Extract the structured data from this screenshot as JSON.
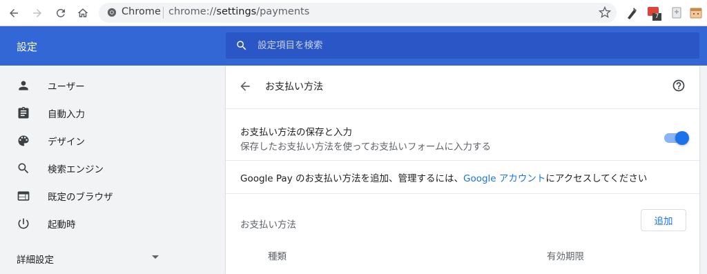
{
  "browser": {
    "omnibox_chrome_label": "Chrome",
    "url_prefix": "chrome://",
    "url_host": "settings",
    "url_path": "/payments",
    "extension_badge": "7"
  },
  "header": {
    "title": "設定",
    "search_placeholder": "設定項目を検索"
  },
  "sidebar": {
    "items": [
      {
        "label": "ユーザー",
        "icon": "person-icon"
      },
      {
        "label": "自動入力",
        "icon": "clipboard-icon"
      },
      {
        "label": "デザイン",
        "icon": "palette-icon"
      },
      {
        "label": "検索エンジン",
        "icon": "search-icon"
      },
      {
        "label": "既定のブラウザ",
        "icon": "browser-window-icon"
      },
      {
        "label": "起動時",
        "icon": "power-icon"
      }
    ],
    "advanced_label": "詳細設定"
  },
  "main": {
    "page_title": "お支払い方法",
    "save_toggle": {
      "title": "お支払い方法の保存と入力",
      "subtitle": "保存したお支払い方法を使ってお支払いフォームに入力する",
      "enabled": true
    },
    "gpay": {
      "prefix": "Google Pay のお支払い方法を追加、管理するには、",
      "link": "Google アカウント",
      "suffix": "にアクセスしてください"
    },
    "section_label": "お支払い方法",
    "add_button": "追加",
    "columns": {
      "type": "種類",
      "expiry": "有効期限"
    }
  },
  "colors": {
    "header_blue": "#3367d6",
    "search_blue": "#2a56c6",
    "link_blue": "#1a73e8",
    "toggle_track": "#8ab4f8"
  }
}
